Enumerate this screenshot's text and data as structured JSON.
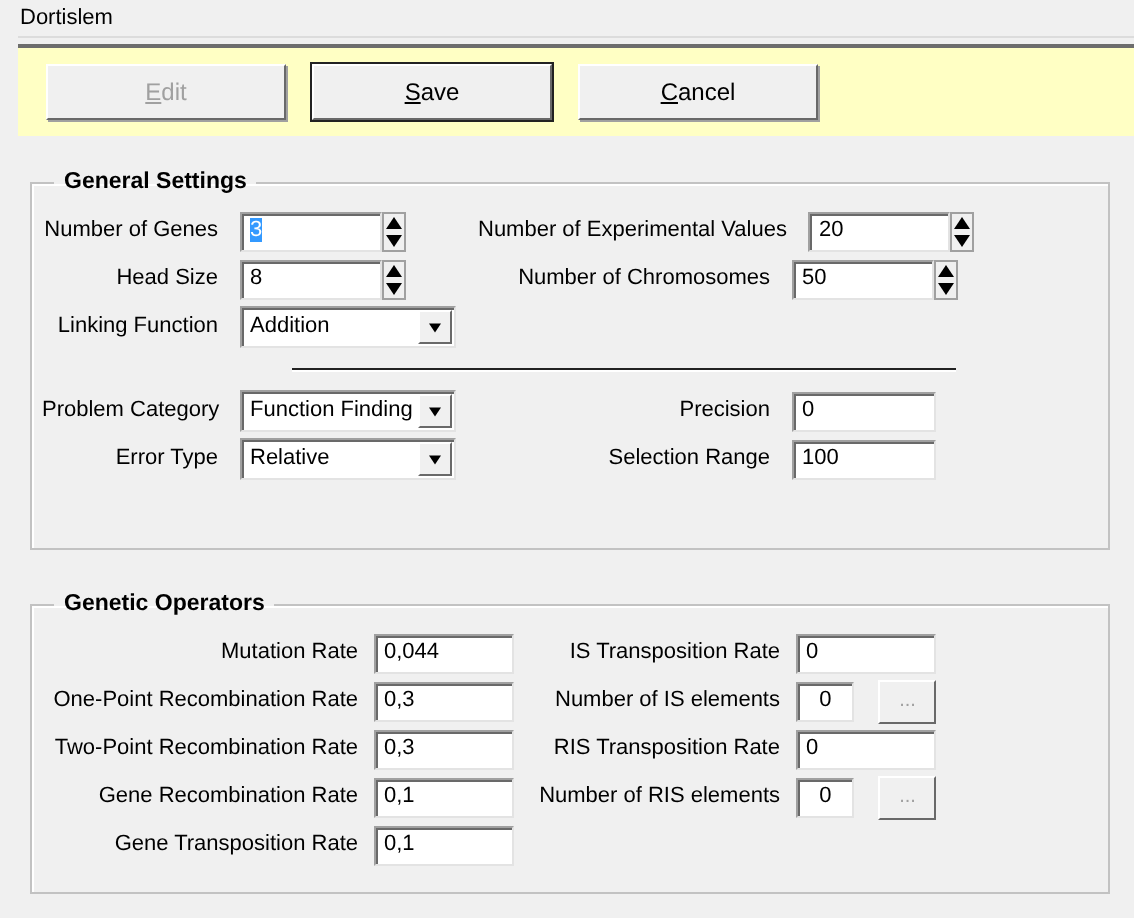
{
  "window": {
    "title": "Dortislem"
  },
  "toolbar": {
    "buttons": [
      {
        "label": "Edit",
        "disabled": true,
        "default": false
      },
      {
        "label": "Save",
        "disabled": false,
        "default": true
      },
      {
        "label": "Cancel",
        "disabled": false,
        "default": false
      }
    ]
  },
  "general_settings": {
    "title": "General Settings",
    "upper_rows": [
      {
        "left": {
          "label": "Number of Genes",
          "value": "3",
          "kind": "spinner",
          "text_selected": true
        },
        "right": {
          "label": "Number of Experimental Values",
          "value": "20",
          "kind": "spinner",
          "text_selected": false
        }
      },
      {
        "left": {
          "label": "Head Size",
          "value": "8",
          "kind": "spinner",
          "text_selected": false
        },
        "right": {
          "label": "Number of Chromosomes",
          "value": "50",
          "kind": "spinner",
          "text_selected": false
        }
      },
      {
        "left": {
          "label": "Linking Function",
          "value": "Addition",
          "kind": "dropdown",
          "text_selected": false
        }
      }
    ],
    "lower_rows": [
      {
        "left": {
          "label": "Problem Category",
          "value": "Function Finding",
          "kind": "dropdown",
          "text_selected": false
        },
        "right": {
          "label": "Precision",
          "value": "0",
          "kind": "text",
          "text_selected": false
        }
      },
      {
        "left": {
          "label": "Error Type",
          "value": "Relative",
          "kind": "dropdown",
          "text_selected": false
        },
        "right": {
          "label": "Selection Range",
          "value": "100",
          "kind": "text",
          "text_selected": false
        }
      }
    ]
  },
  "genetic_operators": {
    "title": "Genetic Operators",
    "rows": [
      {
        "left": {
          "label": "Mutation Rate",
          "value": "0,044"
        },
        "right": {
          "label": "IS Transposition Rate",
          "value": "0",
          "kind": "text"
        }
      },
      {
        "left": {
          "label": "One-Point Recombination Rate",
          "value": "0,3"
        },
        "right": {
          "label": "Number of IS elements",
          "value": "0",
          "kind": "count",
          "button_label": "...",
          "button_disabled": true
        }
      },
      {
        "left": {
          "label": "Two-Point Recombination Rate",
          "value": "0,3"
        },
        "right": {
          "label": "RIS Transposition Rate",
          "value": "0",
          "kind": "text"
        }
      },
      {
        "left": {
          "label": "Gene Recombination Rate",
          "value": "0,1"
        },
        "right": {
          "label": "Number of RIS elements",
          "value": "0",
          "kind": "count",
          "button_label": "...",
          "button_disabled": true
        }
      },
      {
        "left": {
          "label": "Gene Transposition Rate",
          "value": "0,1"
        }
      }
    ]
  }
}
